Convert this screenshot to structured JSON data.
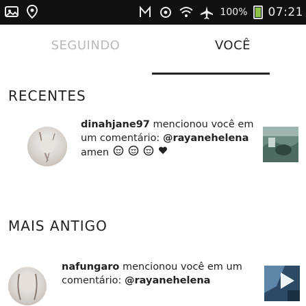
{
  "status_bar": {
    "left_icons": [
      "gallery-icon",
      "location-icon"
    ],
    "right_icons": [
      "nfc-icon",
      "signal-icon",
      "wifi-icon",
      "airplane-icon"
    ],
    "battery_label": "100%",
    "clock": "07:21"
  },
  "tabs": {
    "following": "SEGUINDO",
    "you": "VOCÊ",
    "active": "you"
  },
  "sections": {
    "recent": "RECENTES",
    "older": "MAIS ANTIGO"
  },
  "notifications": {
    "recent": [
      {
        "username": "dinahjane97",
        "line1_rest": " mencionou você em",
        "line2_prefix": "um comentário: ",
        "mention": "@rayanehelena",
        "line3": "amen",
        "emoji_icons": [
          "heart-eyes-emoji-icon",
          "heart-eyes-emoji-icon",
          "heart-eyes-emoji-icon",
          "heart-icon"
        ]
      }
    ],
    "older": [
      {
        "username": "nafungaro",
        "line1_rest": " mencionou você em um",
        "line2_prefix": "comentário: ",
        "mention": "@rayanehelena"
      }
    ]
  },
  "colors": {
    "status_bar_bg": "#111111",
    "tab_inactive": "#b9b9b9",
    "tab_active": "#222222",
    "battery_fill": "#8bc34a"
  }
}
